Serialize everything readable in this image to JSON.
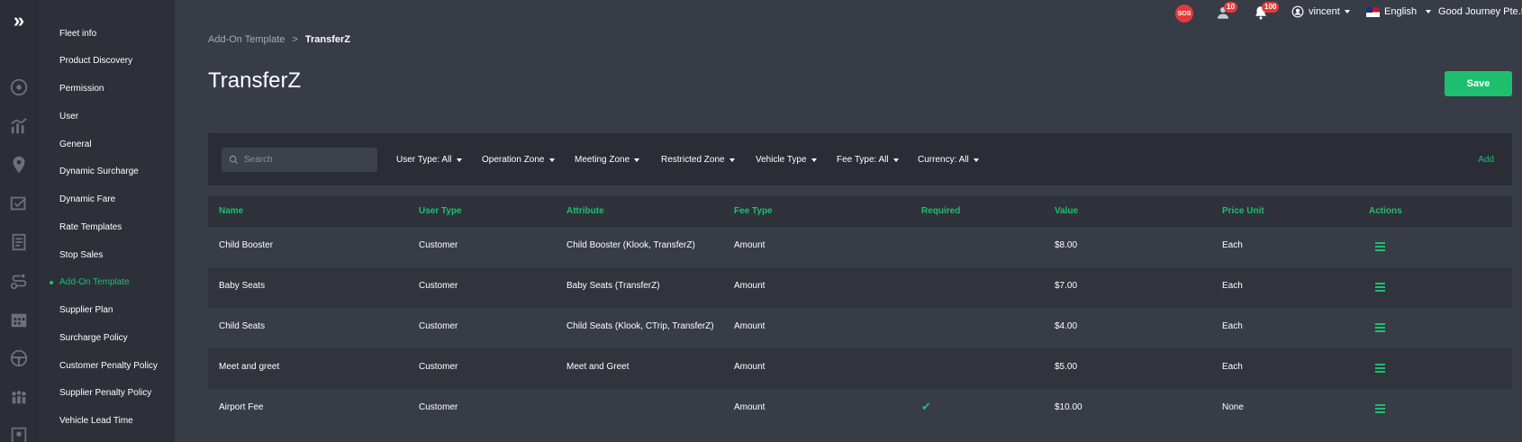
{
  "menu": {
    "items": [
      {
        "label": "Fleet info"
      },
      {
        "label": "Product Discovery"
      },
      {
        "label": "Permission"
      },
      {
        "label": "User"
      },
      {
        "label": "General"
      },
      {
        "label": "Dynamic Surcharge"
      },
      {
        "label": "Dynamic Fare"
      },
      {
        "label": "Rate Templates"
      },
      {
        "label": "Stop Sales"
      },
      {
        "label": "Add-On Template",
        "active": true
      },
      {
        "label": "Supplier Plan"
      },
      {
        "label": "Surcharge Policy"
      },
      {
        "label": "Customer Penalty Policy"
      },
      {
        "label": "Supplier Penalty Policy"
      },
      {
        "label": "Vehicle Lead Time"
      }
    ]
  },
  "rail_icons": [
    "dashboard-icon",
    "analytics-icon",
    "location-pin-icon",
    "booking-icon",
    "report-icon",
    "route-icon",
    "calendar-icon",
    "steering-wheel-icon",
    "people-icon",
    "profile-icon"
  ],
  "topbar": {
    "sos_label": "SOS",
    "driver_badge": "10",
    "notification_badge": "100",
    "user_name": "vincent",
    "language": "English",
    "company": "Good Journey Pte.Ltd"
  },
  "breadcrumb": {
    "parent": "Add-On Template",
    "separator": ">",
    "current": "TransferZ"
  },
  "page_title": "TransferZ",
  "save_label": "Save",
  "filters": {
    "search_placeholder": "Search",
    "user_type": "User Type: All",
    "operation_zone": "Operation Zone",
    "meeting_zone": "Meeting Zone",
    "restricted_zone": "Restricted Zone",
    "vehicle_type": "Vehicle Type",
    "fee_type": "Fee Type: All",
    "currency": "Currency: All",
    "add_label": "Add"
  },
  "table": {
    "columns": [
      "Name",
      "User Type",
      "Attribute",
      "Fee Type",
      "Required",
      "Value",
      "Price Unit",
      "Actions"
    ],
    "rows": [
      {
        "name": "Child Booster",
        "user_type": "Customer",
        "attribute": "Child Booster (Klook, TransferZ)",
        "fee_type": "Amount",
        "required": false,
        "value": "$8.00",
        "price_unit": "Each"
      },
      {
        "name": "Baby Seats",
        "user_type": "Customer",
        "attribute": "Baby Seats (TransferZ)",
        "fee_type": "Amount",
        "required": false,
        "value": "$7.00",
        "price_unit": "Each"
      },
      {
        "name": "Child Seats",
        "user_type": "Customer",
        "attribute": "Child Seats (Klook, CTrip, TransferZ)",
        "fee_type": "Amount",
        "required": false,
        "value": "$4.00",
        "price_unit": "Each"
      },
      {
        "name": "Meet and greet",
        "user_type": "Customer",
        "attribute": "Meet and Greet",
        "fee_type": "Amount",
        "required": false,
        "value": "$5.00",
        "price_unit": "Each"
      },
      {
        "name": "Airport Fee",
        "user_type": "Customer",
        "attribute": "",
        "fee_type": "Amount",
        "required": true,
        "value": "$10.00",
        "price_unit": "None"
      }
    ]
  },
  "colors": {
    "accent": "#1dbf6f",
    "background": "#383c47",
    "sidebar": "#2d3039",
    "alert": "#e23b3b"
  }
}
